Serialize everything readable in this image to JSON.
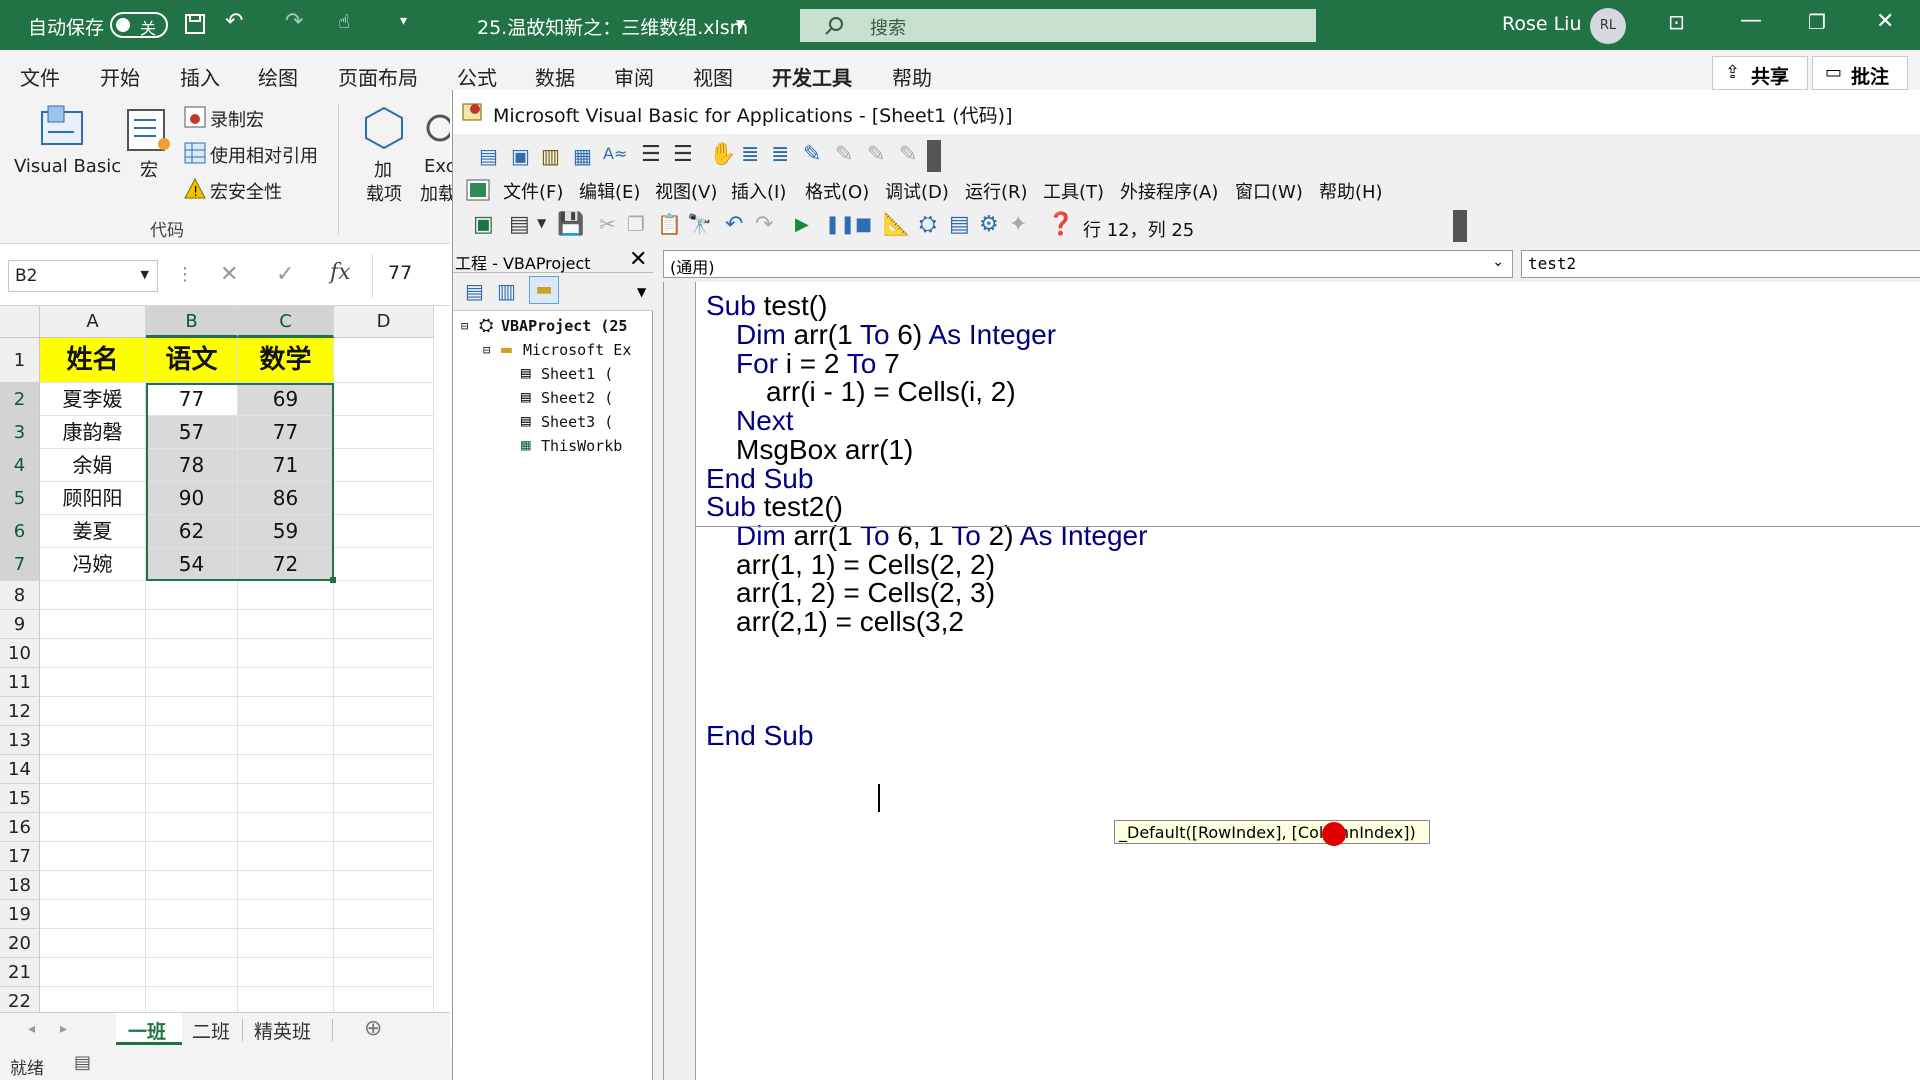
{
  "titlebar": {
    "autosave_label": "自动保存",
    "autosave_state": "关",
    "filename": "25.温故知新之：三维数组.xlsm",
    "search_placeholder": "搜索",
    "user_name": "Rose Liu",
    "user_initials": "RL"
  },
  "ribbon_tabs": [
    "文件",
    "开始",
    "插入",
    "绘图",
    "页面布局",
    "公式",
    "数据",
    "审阅",
    "视图",
    "开发工具",
    "帮助"
  ],
  "active_tab": "开发工具",
  "share_label": "共享",
  "comments_label": "批注",
  "ribbon": {
    "visual_basic": "Visual Basic",
    "macro": "宏",
    "record_macro": "录制宏",
    "relative_ref": "使用相对引用",
    "macro_security": "宏安全性",
    "group_code": "代码",
    "addins_line1": "加",
    "addins_line2": "载项",
    "excel_addins_line1": "Exc",
    "excel_addins_line2": "加载",
    "truncated_group": "加"
  },
  "formula_bar": {
    "name_box": "B2",
    "fx": "fx",
    "value": "77"
  },
  "sheet": {
    "columns": [
      "A",
      "B",
      "C",
      "D"
    ],
    "rows": [
      "1",
      "2",
      "3",
      "4",
      "5",
      "6",
      "7",
      "8",
      "9",
      "10",
      "11",
      "12",
      "13",
      "14",
      "15",
      "16",
      "17",
      "18",
      "19",
      "20",
      "21",
      "22"
    ],
    "headers": [
      "姓名",
      "语文",
      "数学"
    ],
    "data": [
      [
        "夏李媛",
        "77",
        "69"
      ],
      [
        "康韵磬",
        "57",
        "77"
      ],
      [
        "余娟",
        "78",
        "71"
      ],
      [
        "顾阳阳",
        "90",
        "86"
      ],
      [
        "姜夏",
        "62",
        "59"
      ],
      [
        "冯婉",
        "54",
        "72"
      ]
    ],
    "header_fill": "#ffff00",
    "selection_fill": "#d9d9d9"
  },
  "sheet_tabs": [
    "一班",
    "二班",
    "精英班"
  ],
  "status": {
    "ready": "就绪"
  },
  "vba": {
    "title": "Microsoft Visual Basic for Applications - [Sheet1 (代码)]",
    "menus": [
      "文件(F)",
      "编辑(E)",
      "视图(V)",
      "插入(I)",
      "格式(O)",
      "调试(D)",
      "运行(R)",
      "工具(T)",
      "外接程序(A)",
      "窗口(W)",
      "帮助(H)"
    ],
    "cursor_pos": "行 12，列 25",
    "project_panel_title": "工程 - VBAProject",
    "tree": [
      "VBAProject (25",
      "Microsoft Ex",
      "Sheet1 (",
      "Sheet2 (",
      "Sheet3 (",
      "ThisWorkb"
    ],
    "object_combo": "(通用)",
    "proc_combo": "test2",
    "code": [
      {
        "pre": "Sub ",
        "kw2": "",
        "rest": "test()",
        "kw": true,
        "indent": 0
      },
      {
        "indent": 1,
        "parts": [
          [
            "kw",
            "Dim "
          ],
          [
            "",
            "arr(1 "
          ],
          [
            "kw",
            "To "
          ],
          [
            "",
            "6) "
          ],
          [
            "kw",
            "As Integer"
          ]
        ]
      },
      {
        "indent": 1,
        "parts": [
          [
            "kw",
            "For "
          ],
          [
            "",
            "i = 2 "
          ],
          [
            "kw",
            "To "
          ],
          [
            "",
            "7"
          ]
        ]
      },
      {
        "indent": 2,
        "parts": [
          [
            "",
            "arr(i - 1) = Cells(i, 2)"
          ]
        ]
      },
      {
        "indent": 1,
        "parts": [
          [
            "kw",
            "Next"
          ]
        ]
      },
      {
        "indent": 1,
        "parts": [
          [
            "",
            "MsgBox arr(1)"
          ]
        ]
      },
      {
        "indent": 0,
        "parts": [
          [
            "kw",
            "End Sub"
          ]
        ]
      },
      {
        "indent": 0,
        "parts": [
          [
            "kw",
            "Sub "
          ],
          [
            "",
            "test2()"
          ]
        ]
      },
      {
        "indent": 1,
        "parts": [
          [
            "kw",
            "Dim "
          ],
          [
            "",
            "arr(1 "
          ],
          [
            "kw",
            "To "
          ],
          [
            "",
            "6, 1 "
          ],
          [
            "kw",
            "To "
          ],
          [
            "",
            "2) "
          ],
          [
            "kw",
            "As Integer"
          ]
        ]
      },
      {
        "indent": 1,
        "parts": [
          [
            "",
            "arr(1, 1) = Cells(2, 2)"
          ]
        ]
      },
      {
        "indent": 1,
        "parts": [
          [
            "",
            "arr(1, 2) = Cells(2, 3)"
          ]
        ]
      },
      {
        "indent": 1,
        "parts": [
          [
            "",
            "arr(2,1) = cells(3,2"
          ]
        ]
      },
      {
        "indent": 0,
        "parts": [
          [
            "kw",
            "End Sub"
          ]
        ]
      }
    ],
    "tooltip": "_Default([RowIndex], [ColumnIndex])"
  }
}
